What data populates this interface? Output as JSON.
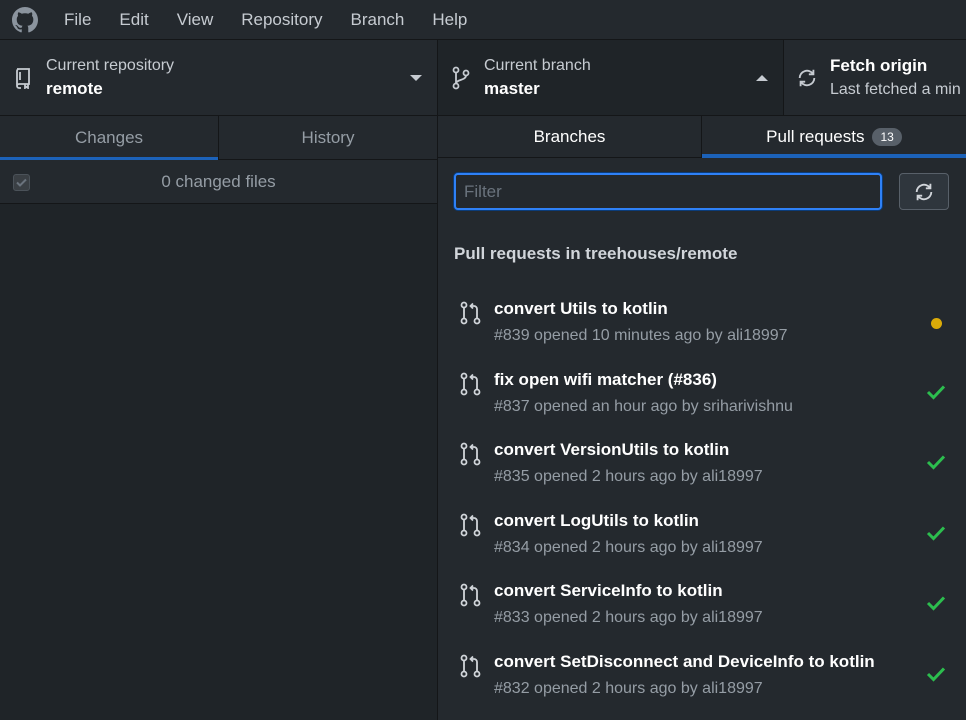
{
  "menu": [
    "File",
    "Edit",
    "View",
    "Repository",
    "Branch",
    "Help"
  ],
  "toolbar": {
    "repo_label": "Current repository",
    "repo_value": "remote",
    "branch_label": "Current branch",
    "branch_value": "master",
    "fetch_label": "Fetch origin",
    "fetch_sub": "Last fetched a min"
  },
  "left": {
    "tabs": [
      "Changes",
      "History"
    ],
    "changed_files": "0 changed files"
  },
  "branch_pane": {
    "tabs": {
      "branches": "Branches",
      "pull_requests": "Pull requests",
      "pr_count": "13"
    },
    "filter_placeholder": "Filter",
    "header": "Pull requests in treehouses/remote",
    "pull_requests": [
      {
        "title": "convert Utils to kotlin",
        "subtitle": "#839 opened 10 minutes ago by ali18997",
        "status": "pending"
      },
      {
        "title": "fix open wifi matcher (#836)",
        "subtitle": "#837 opened an hour ago by sriharivishnu",
        "status": "success"
      },
      {
        "title": "convert VersionUtils to kotlin",
        "subtitle": "#835 opened 2 hours ago by ali18997",
        "status": "success"
      },
      {
        "title": "convert LogUtils to kotlin",
        "subtitle": "#834 opened 2 hours ago by ali18997",
        "status": "success"
      },
      {
        "title": "convert ServiceInfo to kotlin",
        "subtitle": "#833 opened 2 hours ago by ali18997",
        "status": "success"
      },
      {
        "title": "convert SetDisconnect and DeviceInfo to kotlin",
        "subtitle": "#832 opened 2 hours ago by ali18997",
        "status": "success"
      }
    ]
  },
  "colors": {
    "accent": "#1c62b9",
    "pending": "#dbab09",
    "success": "#2cbe4e"
  }
}
